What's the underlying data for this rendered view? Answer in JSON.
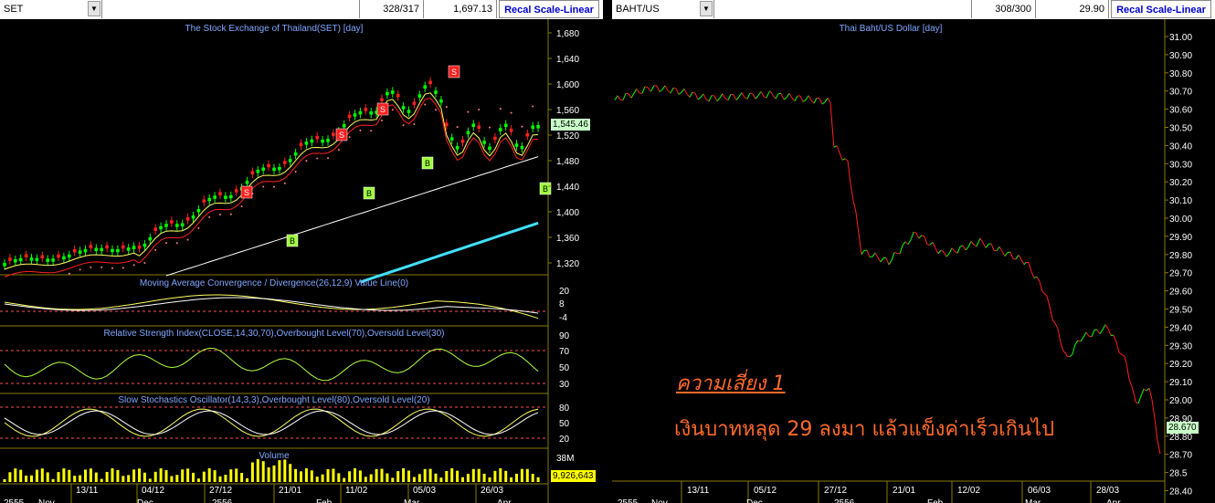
{
  "left": {
    "symbol": "SET",
    "counter": "328/317",
    "last": "1,697.13",
    "recal": "Recal Scale-Linear",
    "title": "The Stock Exchange of Thailand(SET) [day]",
    "price_ticks": [
      "1,680",
      "1,640",
      "1,600",
      "1,560",
      "1,520",
      "1,480",
      "1,440",
      "1,400",
      "1,360",
      "1,320"
    ],
    "price_tag": "1,545.46",
    "macd_title": "Moving Average Convergence / Divergence(26,12,9) Value Line(0)",
    "macd_ticks": [
      "20",
      "8",
      "-4"
    ],
    "rsi_title": "Relative Strength Index(CLOSE,14,30,70),Overbought Level(70),Oversold Level(30)",
    "rsi_ticks": [
      "90",
      "70",
      "50",
      "30"
    ],
    "stoch_title": "Slow Stochastics Oscillator(14,3,3),Overbought Level(80),Oversold Level(20)",
    "stoch_ticks": [
      "80",
      "50",
      "20"
    ],
    "vol_title": "Volume",
    "vol_tick": "38M",
    "vol_tag": "9,926,643",
    "dates": [
      "13/11",
      "04/12",
      "27/12",
      "21/01",
      "11/02",
      "05/03",
      "26/03"
    ],
    "months": [
      "2555",
      "Nov",
      "Dec",
      "2556",
      "Feb",
      "Mar",
      "Apr"
    ],
    "signals": [
      "S",
      "S",
      "S",
      "S",
      "S",
      "B",
      "B",
      "B",
      "B",
      "B"
    ]
  },
  "right": {
    "symbol": "BAHT/US",
    "counter": "308/300",
    "last": "29.90",
    "recal": "Recal Scale-Linear",
    "title": "Thai Baht/US Dollar [day]",
    "ticks": [
      "31.00",
      "30.90",
      "30.80",
      "30.70",
      "30.60",
      "30.50",
      "30.40",
      "30.30",
      "30.20",
      "30.10",
      "30.00",
      "29.90",
      "29.80",
      "29.70",
      "29.60",
      "29.50",
      "29.40",
      "29.30",
      "29.20",
      "29.10",
      "29.00",
      "28.90",
      "28.80",
      "28.70",
      "28.5",
      "28.40"
    ],
    "price_tag": "28.670",
    "dates": [
      "13/11",
      "05/12",
      "27/12",
      "21/01",
      "12/02",
      "06/03",
      "28/03"
    ],
    "months": [
      "2555",
      "Nov",
      "Dec",
      "2556",
      "Feb",
      "Mar",
      "Apr"
    ],
    "annotation_title": "ความเสี่ยง 1",
    "annotation_text": "เงินบาทหลุด 29 ลงมา แล้วแข็งค่าเร็วเกินไป"
  },
  "colors": {
    "up": "#00ff00",
    "down": "#ff2020",
    "grid": "#8a7a00",
    "label": "#7fa7ff",
    "annot": "#ff6a2a",
    "cyan": "#40e0ff"
  }
}
